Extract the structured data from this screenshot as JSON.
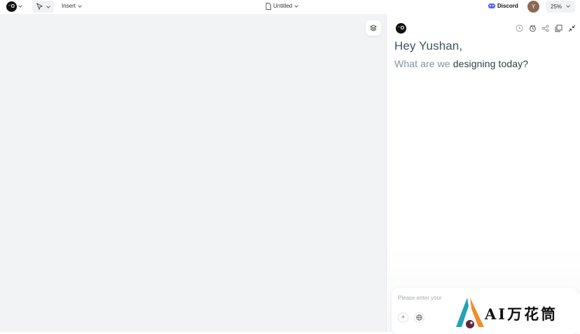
{
  "topbar": {
    "logo_text": "⁻O",
    "insert_label": "Insert",
    "document_title": "Untitled",
    "discord_label": "Discord",
    "avatar_initial": "Y",
    "zoom_label": "25%"
  },
  "panel": {
    "logo_text": "⁻O",
    "greeting": "Hey Yushan,",
    "subtitle_light": "What are we ",
    "subtitle_dark": "designing today?",
    "input_placeholder": "Please enter your",
    "add_glyph": "+"
  },
  "watermark": {
    "text": "AI万花筒"
  },
  "colors": {
    "canvas_bg": "#f2f3f4",
    "discord_brand": "#5865f2",
    "greeting": "#3f5560",
    "subtitle_light": "#7c95a0"
  }
}
